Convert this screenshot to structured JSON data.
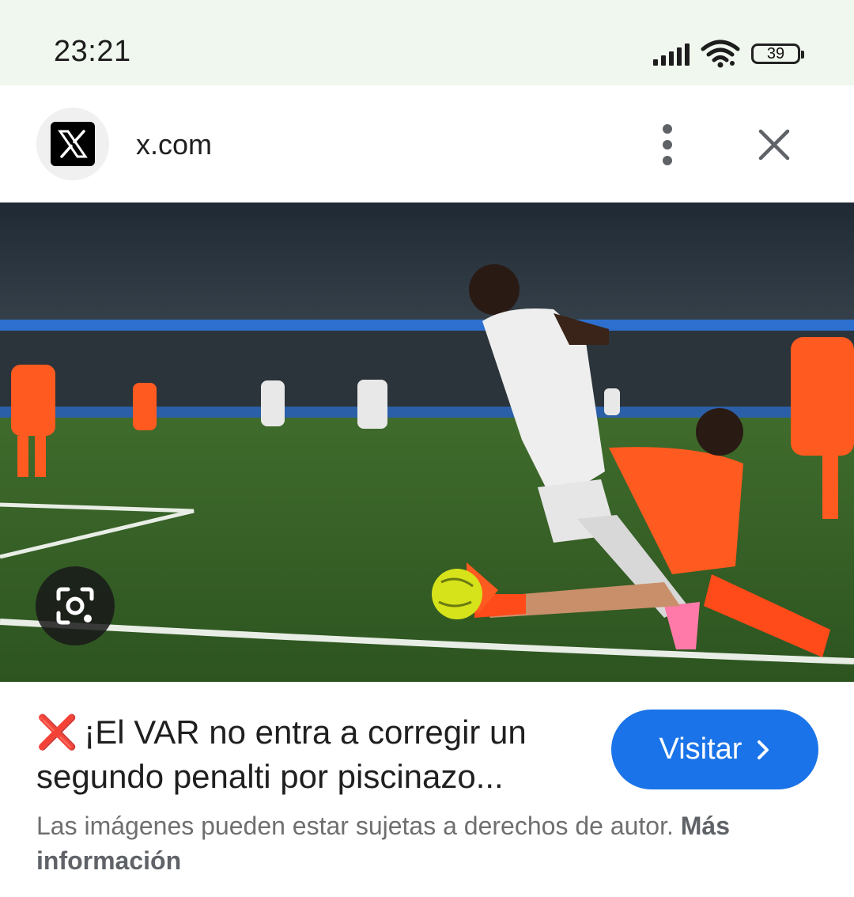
{
  "status_bar": {
    "time": "23:21",
    "battery": "39"
  },
  "header": {
    "site_name": "x.com"
  },
  "result": {
    "caption_icon": "❌",
    "caption": "¡El VAR no entra a corregir un segundo penalti por piscinazo...",
    "visit_label": "Visitar",
    "copyright": "Las imágenes pueden estar sujetas a derechos de autor.",
    "more_info": "Más información"
  },
  "icons": {
    "signal": "signal-icon",
    "wifi": "wifi-icon",
    "battery": "battery-icon",
    "site": "x-logo-icon",
    "menu": "more-vert-icon",
    "close": "close-icon",
    "lens": "google-lens-icon",
    "chevron": "chevron-right-icon"
  },
  "colors": {
    "accent": "#1a73e8",
    "status_bg": "#f0f7ee",
    "error": "#e0312b"
  }
}
